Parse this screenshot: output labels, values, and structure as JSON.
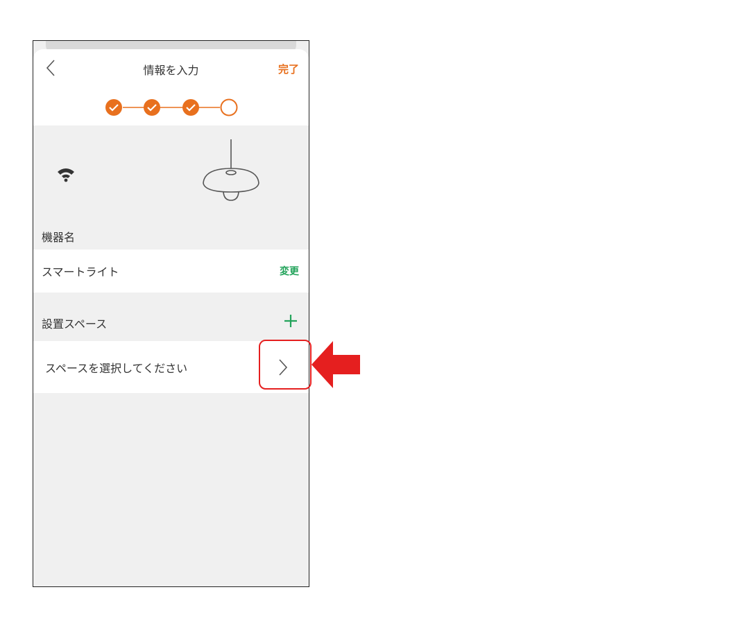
{
  "header": {
    "title": "情報を入力",
    "done_label": "完了"
  },
  "steps": {
    "total": 4,
    "completed": 3,
    "accent": "#e8701e"
  },
  "hero": {
    "wifi_icon": "wifi-icon",
    "device_icon": "pendant-lamp-icon"
  },
  "device_name": {
    "label": "機器名",
    "value": "スマートライト",
    "change_label": "変更"
  },
  "install_space": {
    "label": "設置スペース",
    "add_icon": "plus-icon",
    "placeholder": "スペースを選択してください",
    "chevron_icon": "chevron-right-icon"
  },
  "colors": {
    "accent_orange": "#e8701e",
    "accent_green": "#22a35a",
    "annotation_red": "#e51f1f"
  }
}
